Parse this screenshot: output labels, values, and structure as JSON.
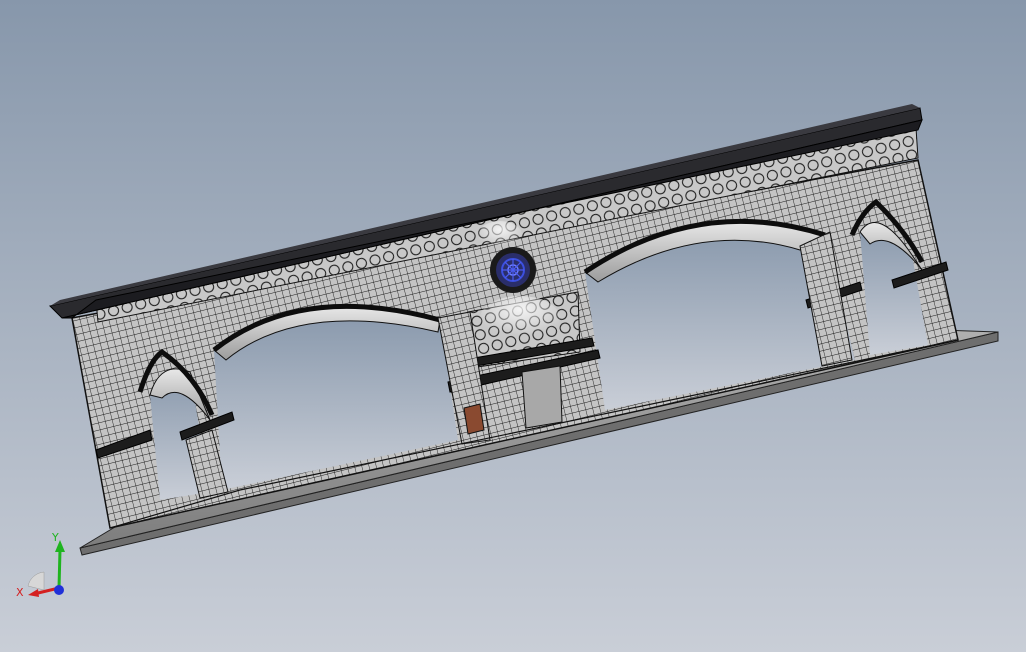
{
  "viewport": {
    "background_top": "#8797ab",
    "background_bottom": "#c9ced7",
    "model_color": "#bdbdbd",
    "edge_color": "#111111",
    "cornice_color": "#1f1f24",
    "rosette_color": "#2a3cc8",
    "door_color": "#8a4a30"
  },
  "triad": {
    "x_label": "X",
    "y_label": "Y",
    "x_color": "#d42020",
    "y_color": "#1fb41f",
    "z_color": "#2030d8"
  }
}
